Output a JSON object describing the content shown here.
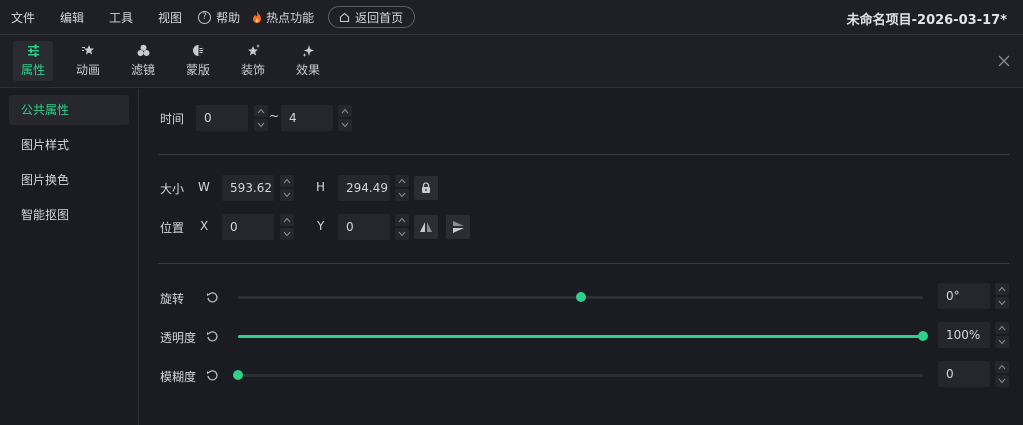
{
  "menu": {
    "items": [
      "文件",
      "编辑",
      "工具",
      "视图"
    ],
    "help": "帮助",
    "help_glyph": "?",
    "hot": "热点功能",
    "back": "返回首页",
    "project_title": "未命名项目-2026-03-17*"
  },
  "tools": [
    {
      "label": "属性",
      "icon": "sliders-icon",
      "active": true
    },
    {
      "label": "动画",
      "icon": "star-motion-icon",
      "active": false
    },
    {
      "label": "滤镜",
      "icon": "circles-icon",
      "active": false
    },
    {
      "label": "蒙版",
      "icon": "half-circle-icon",
      "active": false
    },
    {
      "label": "装饰",
      "icon": "sparkle-star-icon",
      "active": false
    },
    {
      "label": "效果",
      "icon": "sparkle-icon",
      "active": false
    }
  ],
  "sidebar": {
    "items": [
      {
        "label": "公共属性",
        "active": true
      },
      {
        "label": "图片样式",
        "active": false
      },
      {
        "label": "图片换色",
        "active": false
      },
      {
        "label": "智能抠图",
        "active": false
      }
    ]
  },
  "time": {
    "label": "时间",
    "start": "0",
    "separator": "~",
    "end": "4"
  },
  "size": {
    "label": "大小",
    "w_label": "W",
    "w": "593.62",
    "h_label": "H",
    "h": "294.49"
  },
  "position": {
    "label": "位置",
    "x_label": "X",
    "x": "0",
    "y_label": "Y",
    "y": "0"
  },
  "rotate": {
    "label": "旋转",
    "value": "0°",
    "level": 0.5
  },
  "opacity": {
    "label": "透明度",
    "value": "100%",
    "level": 1.0
  },
  "blur": {
    "label": "模糊度",
    "value": "0",
    "level": 0.0
  },
  "colors": {
    "accent": "#2fd08a",
    "bg": "#1b1c21",
    "input": "#25272c"
  }
}
